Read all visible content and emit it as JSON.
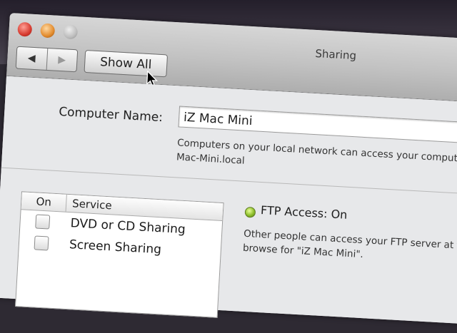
{
  "window": {
    "title": "Sharing"
  },
  "toolbar": {
    "back_icon": "◀",
    "forward_icon": "▶",
    "show_all_label": "Show All"
  },
  "computer_name": {
    "label": "Computer Name:",
    "value": "iZ Mac Mini",
    "help_line1": "Computers on your local network can access your computer",
    "help_line2": "Mac-Mini.local"
  },
  "services": {
    "header_on": "On",
    "header_service": "Service",
    "items": [
      {
        "label": "DVD or CD Sharing",
        "checked": false
      },
      {
        "label": "Screen Sharing",
        "checked": false
      }
    ]
  },
  "status": {
    "text": "FTP Access: On",
    "color": "#8fbf2c",
    "help_line1": "Other people can access your FTP server at ftp",
    "help_line2": "browse for \"iZ Mac Mini\"."
  },
  "colors": {
    "window_bg": "#e9eaec",
    "titlebar": "#c2c2c2",
    "close": "#d63a2f",
    "minimize": "#e28b2d",
    "zoom": "#bdbdbd"
  }
}
